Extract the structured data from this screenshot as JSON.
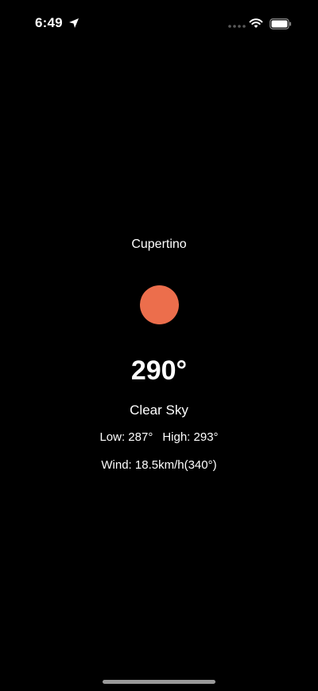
{
  "status_bar": {
    "time": "6:49",
    "location_icon": "location-arrow-icon",
    "signal_icon": "cellular-signal-icon",
    "wifi_icon": "wifi-icon",
    "battery_icon": "battery-icon"
  },
  "weather": {
    "city": "Cupertino",
    "icon": "sun-icon",
    "icon_color": "#ec6e4c",
    "temperature": "290°",
    "condition": "Clear Sky",
    "low": "Low: 287°",
    "high": "High: 293°",
    "wind": "Wind: 18.5km/h(340°)"
  }
}
